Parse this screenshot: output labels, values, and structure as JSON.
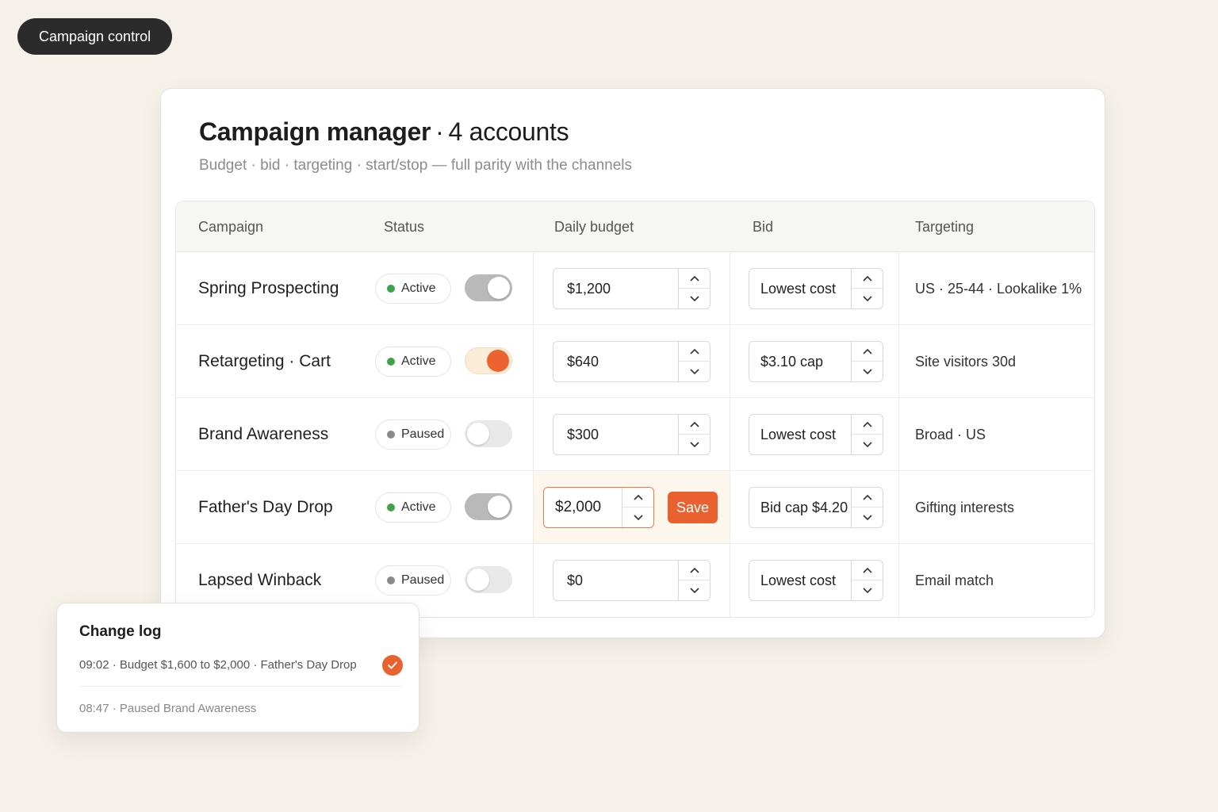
{
  "tag": {
    "label": "Campaign control"
  },
  "card": {
    "title_main": "Campaign manager",
    "title_sep": "·",
    "title_sub": "4 accounts",
    "subtitle": "Budget · bid · targeting · start/stop — full parity with the channels"
  },
  "table": {
    "headers": [
      "Campaign",
      "Status",
      "Daily budget",
      "Bid",
      "Targeting"
    ],
    "rows": [
      {
        "name": "Spring Prospecting",
        "status": "Active",
        "toggle": "on",
        "budget": "$1,200",
        "bid": "Lowest cost",
        "targeting": "US · 25-44 · Lookalike 1%"
      },
      {
        "name": "Retargeting · Cart",
        "status": "Active",
        "toggle": "on",
        "budget": "$640",
        "bid": "$3.10 cap",
        "targeting": "Site visitors 30d"
      },
      {
        "name": "Brand Awareness",
        "status": "Paused",
        "toggle": "off",
        "budget": "$300",
        "bid": "Lowest cost",
        "targeting": "Broad · US"
      },
      {
        "name": "Father's Day Drop",
        "status": "Active",
        "toggle": "on",
        "budget": "$2,000",
        "bid": "Bid cap $4.20",
        "targeting": "Gifting interests",
        "save_label": "Save"
      },
      {
        "name": "Lapsed Winback",
        "status": "Paused",
        "toggle": "off",
        "budget": "$0",
        "bid": "Lowest cost",
        "targeting": "Email match"
      }
    ]
  },
  "change_log": {
    "title": "Change log",
    "entries": [
      "09:02 · Budget $1,600 to $2,000 · Father's Day Drop",
      "08:47 · Paused Brand Awareness"
    ]
  },
  "colors": {
    "accent": "#e8612f",
    "active_dot": "#3fa34d",
    "paused_dot": "#8a8a8a",
    "background": "#f5f1e9"
  },
  "icons": [
    "chevron-up-icon",
    "chevron-down-icon",
    "check-icon"
  ]
}
